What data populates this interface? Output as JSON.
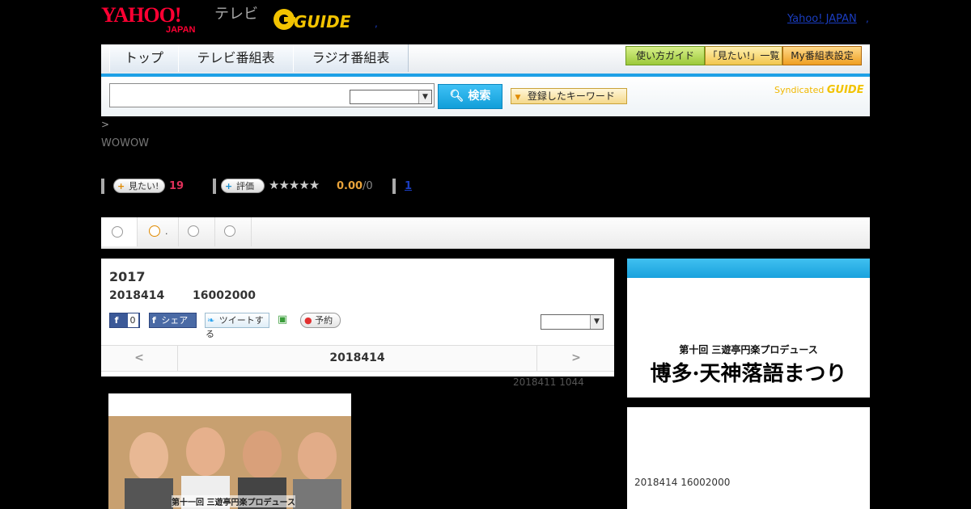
{
  "header": {
    "yahoo_logo": "YAHOO!",
    "yahoo_sub": "JAPAN",
    "tv_label": "テレビ",
    "gguide_logo": "GUIDE",
    "yahoo_japan_link": "Yahoo! JAPAN",
    "sep_left": ",",
    "sep_right": ","
  },
  "nav": {
    "tabs": [
      {
        "label": "トップ"
      },
      {
        "label": "テレビ番組表"
      },
      {
        "label": "ラジオ番組表"
      }
    ],
    "right_buttons": [
      {
        "label": "使い方ガイド",
        "color": "#b5d84a"
      },
      {
        "label": "「見たい!」一覧",
        "color": "#f7d46a"
      },
      {
        "label": "My番組表設定",
        "color": "#f1b53b"
      }
    ]
  },
  "search": {
    "placeholder": "",
    "select_value": "",
    "button_label": "検索",
    "keyword_button_label": "登録したキーワード",
    "syndicated_label": "Syndicated"
  },
  "breadcrumb": ">",
  "channel": "WOWOW",
  "stats": {
    "want_label": "見たい!",
    "want_count": "19",
    "rate_label": "評価",
    "rating": "0.00",
    "rating_count": "/0",
    "rating_stars": 0,
    "review_link": "1"
  },
  "tabstrip": {
    "tab2_suffix": "."
  },
  "program": {
    "title": "2017",
    "date": "2018414",
    "time": "16002000",
    "share_count": "0",
    "share_label": "シェア",
    "tweet_label": "ツイートする",
    "reserve_label": "予約",
    "select_value": ""
  },
  "pager": {
    "prev": "<",
    "current": "2018414",
    "next": ">"
  },
  "updated": "2018411  1044",
  "right": {
    "banner_line1": "第十回 三遊亭円楽プロデュース",
    "banner_line2": "博多·天神落語まつり",
    "info": "2018414  16002000"
  },
  "thumb": {
    "caption": "第十一回 三遊亭円楽プロデュース"
  },
  "colors": {
    "accent_blue": "#1ea0e6",
    "want_count_color": "#e0305a",
    "rating_color": "#e8a23a"
  }
}
